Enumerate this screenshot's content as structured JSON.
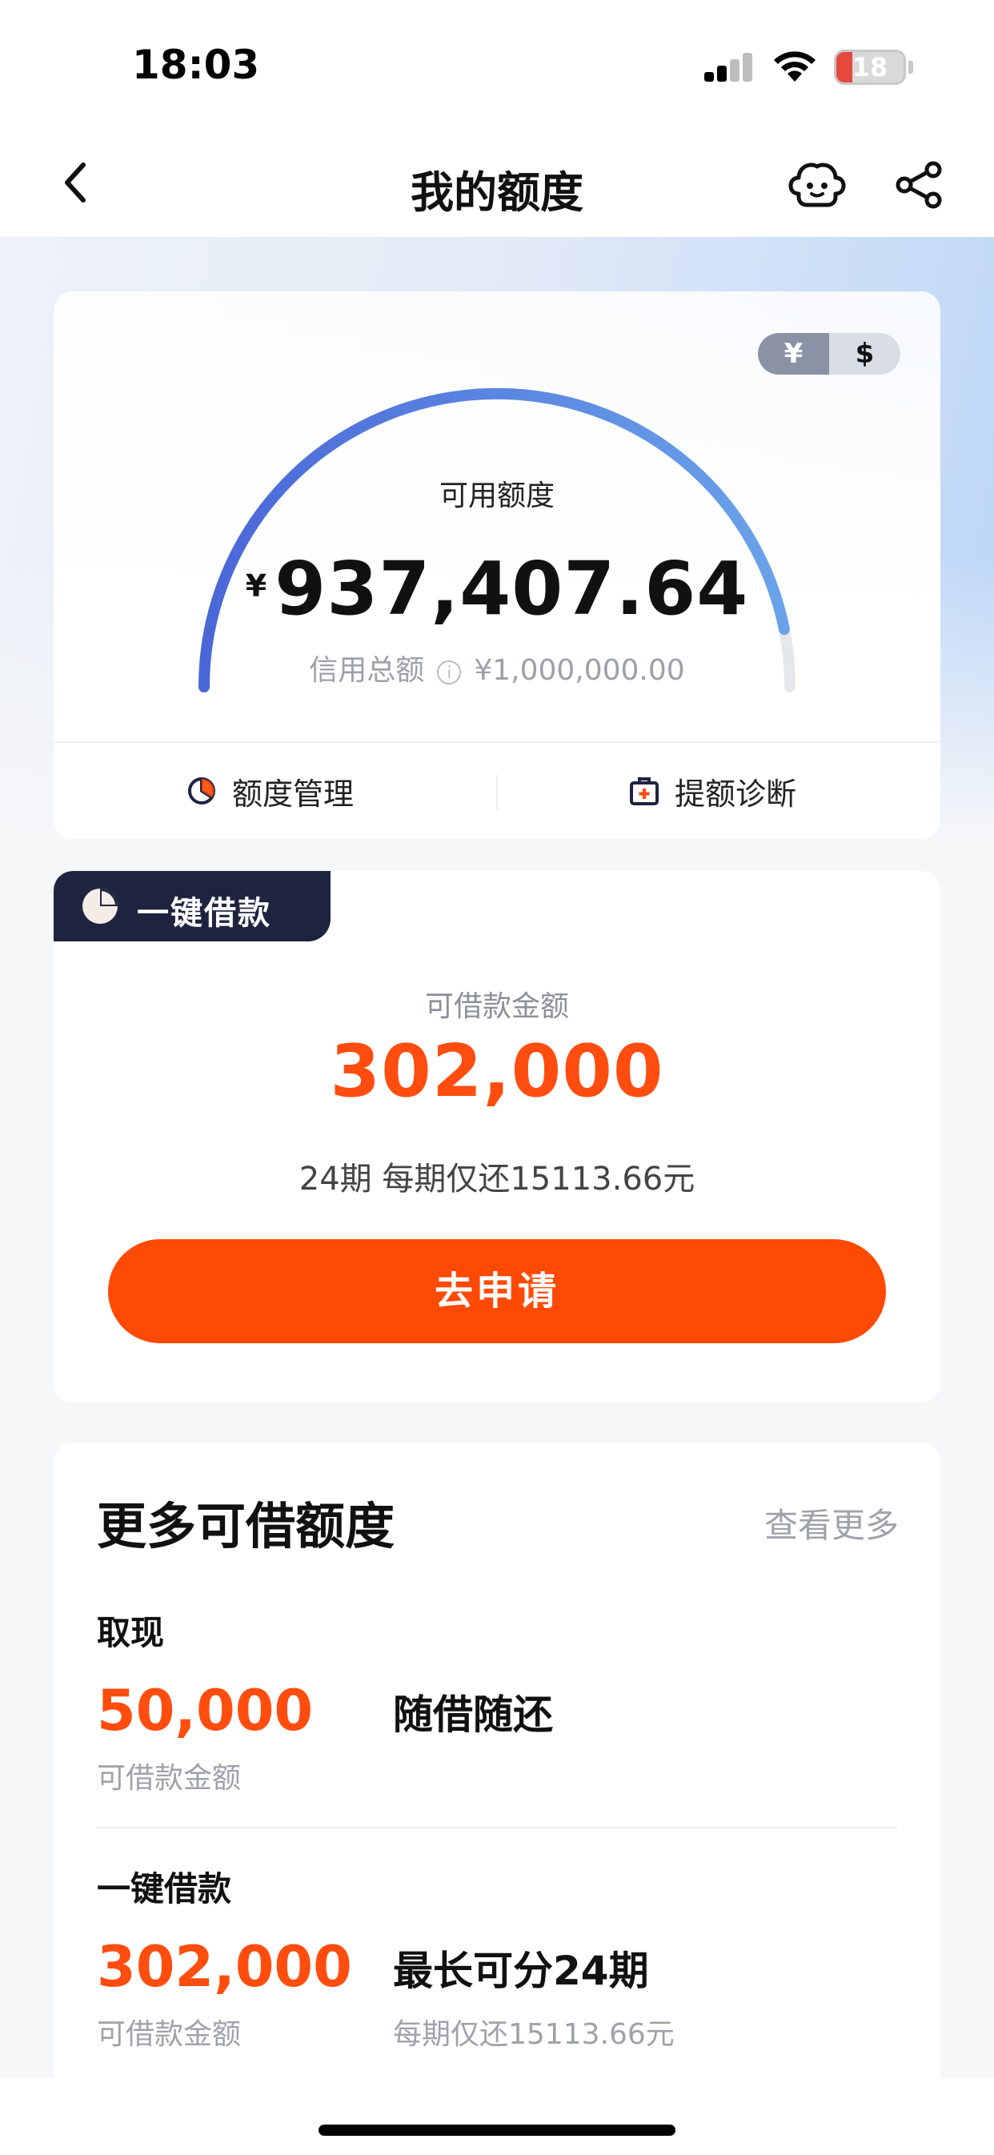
{
  "status_bar": {
    "time": "18:03",
    "battery": "18",
    "colors": {
      "battery_low": "#e5483c"
    }
  },
  "nav": {
    "title": "我的额度",
    "icons": [
      "back-arrow-icon",
      "robot-icon",
      "share-icon"
    ]
  },
  "quota_card": {
    "currency_options": [
      "¥",
      "$"
    ],
    "selected_currency": "¥",
    "label": "可用额度",
    "currency_symbol": "¥",
    "available": "937,407.64",
    "total_label": "信用总额",
    "total_value": "¥1,000,000.00",
    "usage_fraction": 0.937,
    "actions": [
      {
        "label": "额度管理",
        "icon": "pie-chart-icon"
      },
      {
        "label": "提额诊断",
        "icon": "medical-kit-icon"
      }
    ],
    "colors": {
      "gauge_start": "#4a67d8",
      "gauge_end": "#6aa3e9",
      "gauge_track": "#e6e7ea"
    }
  },
  "loan_card": {
    "badge": "一键借款",
    "sub_label": "可借款金额",
    "amount": "302,000",
    "term": "24期 每期仅还15113.66元",
    "apply_button": "去申请",
    "colors": {
      "accent": "#ff4a05",
      "badge_bg": "#1e2440"
    }
  },
  "more_card": {
    "title": "更多可借额度",
    "view_more": "查看更多",
    "items": [
      {
        "name": "取现",
        "amount": "50,000",
        "amount_label": "可借款金额",
        "feature": "随借随还",
        "feature_sub": ""
      },
      {
        "name": "一键借款",
        "amount": "302,000",
        "amount_label": "可借款金额",
        "feature": "最长可分24期",
        "feature_sub": "每期仅还15113.66元"
      }
    ]
  }
}
